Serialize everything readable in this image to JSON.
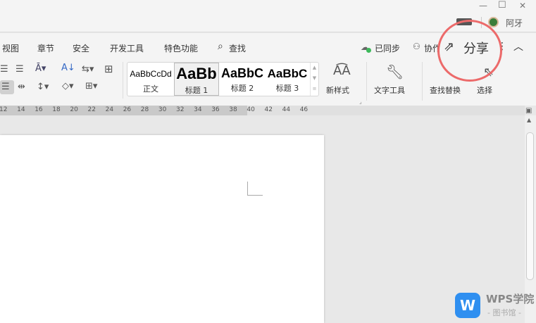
{
  "window": {
    "minimize": "—",
    "maximize": "☐",
    "close": "✕",
    "user": "阿牙"
  },
  "tabs": [
    "视图",
    "章节",
    "安全",
    "开发工具",
    "特色功能",
    "查找"
  ],
  "right_actions": {
    "sync": "已同步",
    "collab": "协作",
    "share": "分享",
    "more": "⋮",
    "collapse": "︿"
  },
  "styles": [
    {
      "preview": "AaBbCcDd",
      "label": "正文"
    },
    {
      "preview": "AaBb",
      "label": "标题 1"
    },
    {
      "preview": "AaBbC",
      "label": "标题 2"
    },
    {
      "preview": "AaBbC",
      "label": "标题 3"
    }
  ],
  "tools": {
    "new_style": "新样式",
    "text_tools": "文字工具",
    "find_replace": "查找替换",
    "select": "选择"
  },
  "ruler": [
    "12",
    "14",
    "16",
    "18",
    "20",
    "22",
    "24",
    "26",
    "28",
    "30",
    "32",
    "34",
    "36",
    "38",
    "40",
    "42",
    "44",
    "46"
  ],
  "watermark": {
    "brand": "WPS学院",
    "sub": "- 图书馆 -",
    "logo": "W"
  },
  "colors": {
    "highlight_circle": "#ec6a6a",
    "wps_blue": "#2f8ff0",
    "sync_green": "#3cb95a"
  }
}
